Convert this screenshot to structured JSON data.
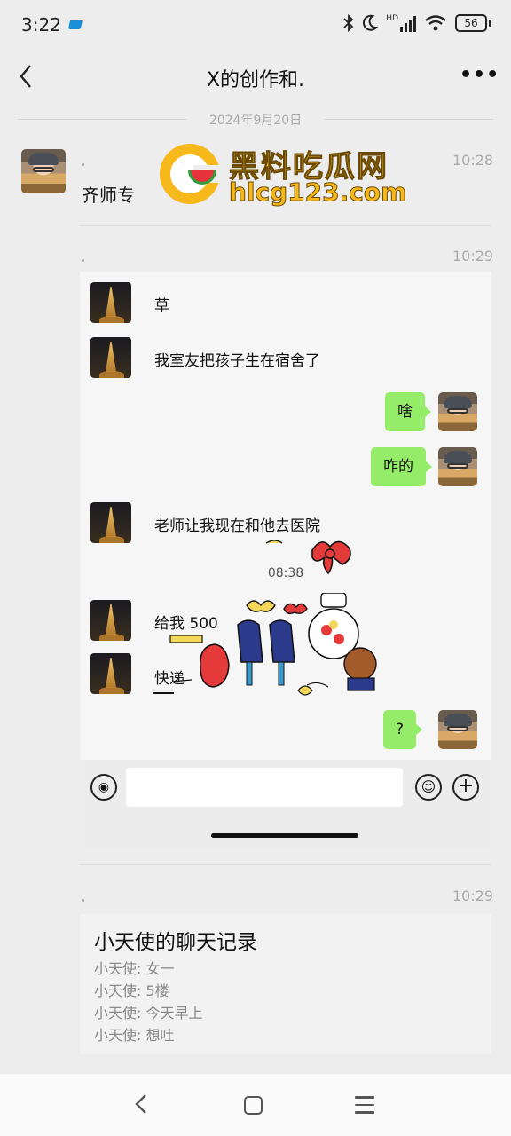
{
  "status_bar": {
    "time": "3:22",
    "right_icons": [
      "bluetooth-icon",
      "moon-icon",
      "hd-signal-icon",
      "wifi-icon"
    ],
    "hd_label": "HD",
    "battery": "56"
  },
  "header": {
    "title": "X的创作和.",
    "back_icon": "back-chevron-icon",
    "more_icon": "more-dots-icon"
  },
  "date_divider": "2024年9月20日",
  "watermark": {
    "title": "黑料吃瓜网",
    "url": "hlcg123.com"
  },
  "posts": [
    {
      "time": "10:28",
      "text": "齐师专"
    },
    {
      "time": "10:29",
      "embedded_chat": {
        "messages": [
          {
            "side": "left",
            "text": "草"
          },
          {
            "side": "left",
            "text": "我室友把孩子生在宿舍了"
          },
          {
            "side": "right",
            "text": "啥"
          },
          {
            "side": "right",
            "text": "咋的"
          },
          {
            "side": "left",
            "text": "老师让我现在和他去医院"
          },
          {
            "side": "left",
            "text": "给我 500"
          },
          {
            "side": "left",
            "text": "快递"
          },
          {
            "side": "right",
            "text": "?"
          }
        ],
        "time_label": "08:38"
      }
    },
    {
      "time": "10:29",
      "card": {
        "title": "小天使的聊天记录",
        "lines": [
          "小天使: 女一",
          "小天使: 5楼",
          "小天使: 今天早上",
          "小天使: 想吐"
        ]
      }
    }
  ],
  "colors": {
    "bubble_green": "#95ec69",
    "background": "#ededed",
    "watermark_yellow": "#f6b81a"
  },
  "nav_bar": {
    "icons": [
      "nav-back-icon",
      "nav-home-icon",
      "nav-menu-icon"
    ]
  }
}
